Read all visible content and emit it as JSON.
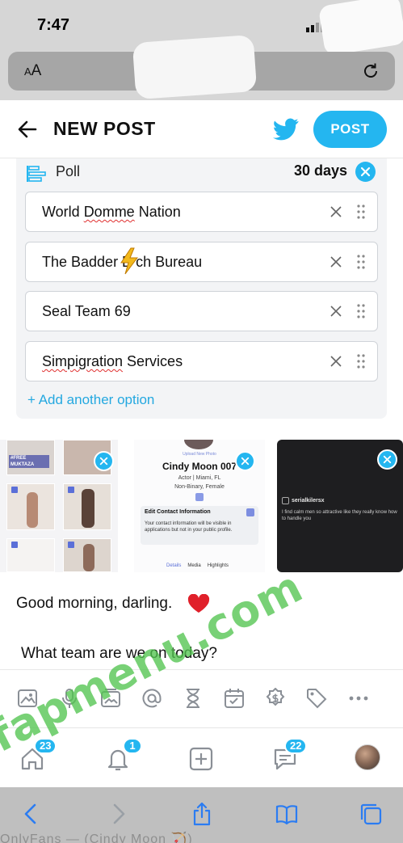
{
  "status_bar": {
    "time": "7:47"
  },
  "safari": {
    "text_size_label_small": "A",
    "text_size_label_large": "A",
    "bottom_bg_text": "OnlyFans — (Cindy Moon 🏹)"
  },
  "header": {
    "title": "NEW POST",
    "post_label": "POST"
  },
  "poll": {
    "label": "Poll",
    "duration": "30 days",
    "options": [
      {
        "pre": "World ",
        "squiggle": "Domme",
        "post": " Nation"
      },
      {
        "pre": "The Badder B",
        "squiggle": "",
        "post": "  ch Bureau"
      },
      {
        "pre": "Seal Team 69",
        "squiggle": "",
        "post": ""
      },
      {
        "pre": "",
        "squiggle": "Simpigration",
        "post": " Services"
      }
    ],
    "add_option": "+ Add another option"
  },
  "media": {
    "thumb1_tag": "#FREE MUKTAZA",
    "profile": {
      "upload_label": "Upload New Photo",
      "name": "Cindy Moon 007",
      "line1": "Actor  |  Miami, FL",
      "line2": "Non-Binary, Female",
      "contact_title": "Edit Contact Information",
      "contact_body": "Your contact information will be visible in applications but not in your public profile.",
      "tabs": [
        "Details",
        "Media",
        "Highlights"
      ]
    },
    "dm": {
      "username": "serialkilersx",
      "message": "I find calm men so attractive like they really know how to handle you"
    }
  },
  "post_body": {
    "line1": "Good morning, darling.",
    "line2": "What team are we on today?"
  },
  "toolbar": {
    "icons": [
      "image-icon",
      "microphone-icon",
      "gallery-icon",
      "mention-icon",
      "hourglass-icon",
      "calendar-icon",
      "price-icon",
      "tag-icon",
      "more-icon"
    ]
  },
  "nav": {
    "home_badge": "23",
    "notifications_badge": "1",
    "messages_badge": "22"
  },
  "watermark": "fapmenu.com",
  "colors": {
    "accent": "#24b6f0",
    "link": "#24a8e0",
    "watermark": "#52c450"
  }
}
